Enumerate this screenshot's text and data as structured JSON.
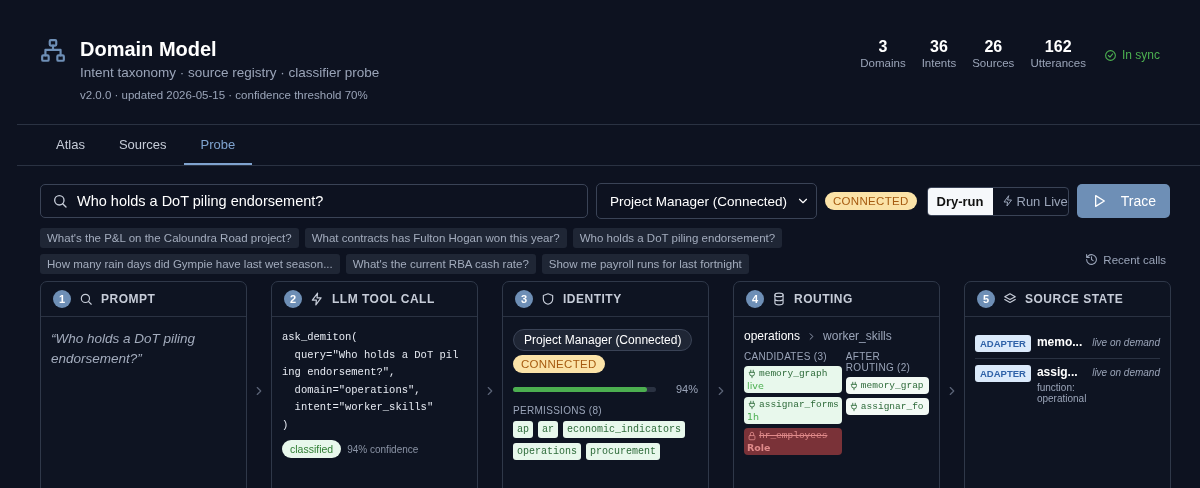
{
  "header": {
    "title": "Domain Model",
    "subtitle": "Intent taxonomy · source registry · classifier probe",
    "meta": "v2.0.0 · updated 2026-05-15 · confidence threshold 70%",
    "stats": [
      {
        "value": "3",
        "label": "Domains"
      },
      {
        "value": "36",
        "label": "Intents"
      },
      {
        "value": "26",
        "label": "Sources"
      },
      {
        "value": "162",
        "label": "Utterances"
      }
    ],
    "sync": "In sync"
  },
  "tabs": [
    {
      "label": "Atlas",
      "selected": false
    },
    {
      "label": "Sources",
      "selected": false
    },
    {
      "label": "Probe",
      "selected": true
    }
  ],
  "probe": {
    "query": "Who holds a DoT piling endorsement?",
    "identity": "Project Manager (Connected)",
    "status": "CONNECTED",
    "modes": [
      {
        "label": "Dry-run",
        "selected": true
      },
      {
        "label": "Run Live",
        "selected": false
      }
    ],
    "trace": "Trace",
    "examples": [
      "What's the P&L on the Caloundra Road project?",
      "What contracts has Fulton Hogan won this year?",
      "Who holds a DoT piling endorsement?",
      "How many rain days did Gympie have last wet season...",
      "What's the current RBA cash rate?",
      "Show me payroll runs for last fortnight"
    ],
    "recent": "Recent calls"
  },
  "steps": [
    {
      "number": "1",
      "title": "PROMPT",
      "kind": "prompt",
      "prompt": "“Who holds a DoT piling endorsement?”"
    },
    {
      "number": "2",
      "title": "LLM TOOL CALL",
      "kind": "call",
      "code": [
        "ask_demiton(",
        "  query=\"Who holds a DoT pil",
        "ing endorsement?\",",
        "  domain=\"operations\",",
        "  intent=\"worker_skills\"",
        ")"
      ],
      "badge": "classified",
      "confidence": "94% confidence"
    },
    {
      "number": "3",
      "title": "IDENTITY",
      "kind": "identity",
      "role": "Project Manager (Connected)",
      "status": "CONNECTED",
      "level": 0.94,
      "percent": "94%",
      "permissions_label": "PERMISSIONS (8)",
      "permissions": [
        "ap",
        "ar",
        "economic_indicators",
        "operations",
        "procurement"
      ]
    },
    {
      "number": "4",
      "title": "ROUTING",
      "kind": "routing",
      "domain": "operations",
      "intent": "worker_skills",
      "candidates_label": "CANDIDATES (3)",
      "after_label": "AFTER ROUTING (2)",
      "candidates": [
        {
          "name": "memory_graph",
          "tag": "live",
          "blocked": false
        },
        {
          "name": "assignar_forms",
          "tag": "1h",
          "blocked": false
        },
        {
          "name": "hr_employees",
          "tag": "Role",
          "blocked": true
        }
      ],
      "after": [
        "memory_grap",
        "assignar_fo"
      ]
    },
    {
      "number": "5",
      "title": "SOURCE STATE",
      "kind": "sources",
      "sources": [
        {
          "badge": "ADAPTER",
          "name": "memo...",
          "mode": "live on demand"
        },
        {
          "badge": "ADAPTER",
          "name": "assig...",
          "mode": "live on demand",
          "detail": "function: operational"
        }
      ]
    }
  ]
}
